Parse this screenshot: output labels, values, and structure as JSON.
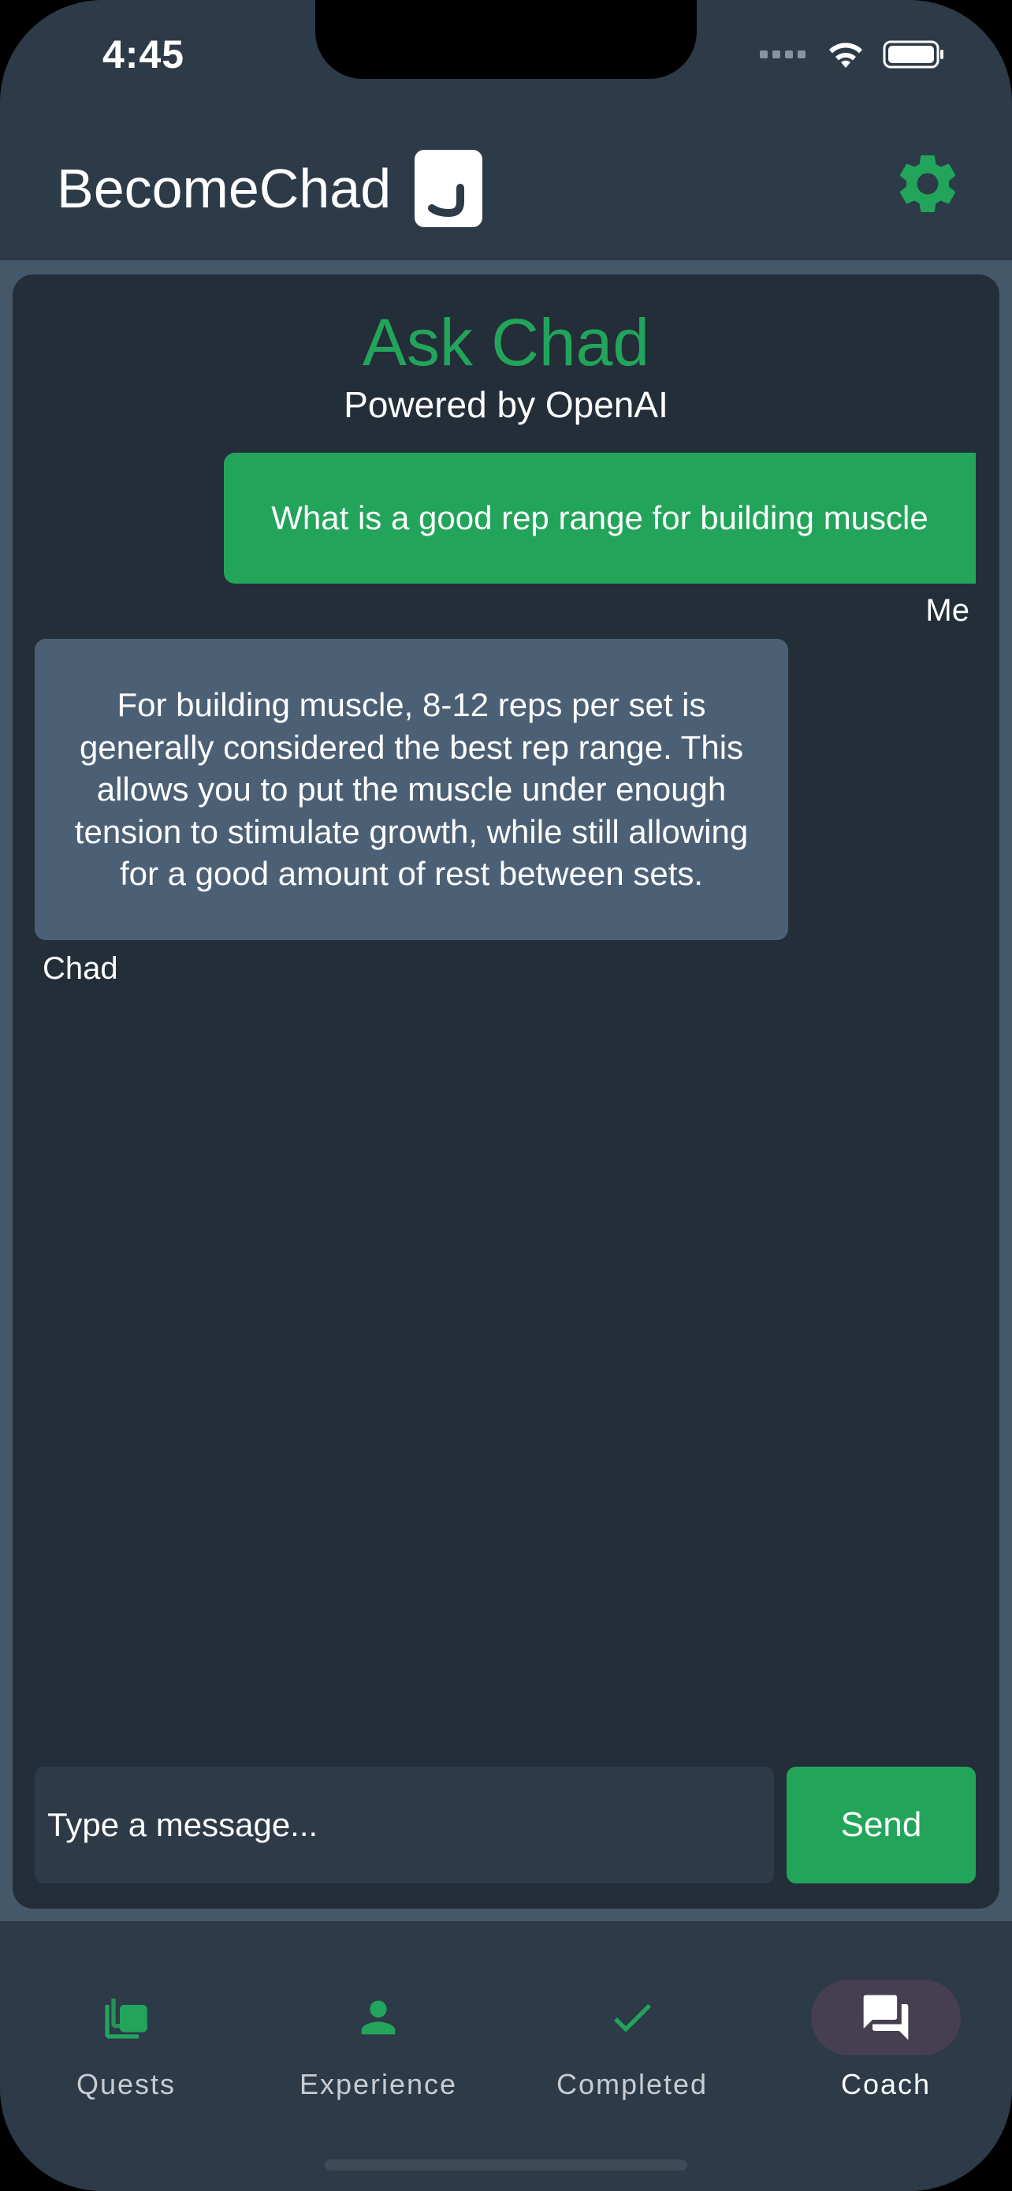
{
  "status_bar": {
    "time": "4:45"
  },
  "header": {
    "brand": "BecomeChad",
    "settings_icon": "gear-icon"
  },
  "chat": {
    "title": "Ask Chad",
    "subtitle": "Powered by OpenAI",
    "messages": [
      {
        "sender": "Me",
        "text": "What is a good rep range for building muscle"
      },
      {
        "sender": "Chad",
        "text": "For building muscle, 8-12 reps per set is generally considered the best rep range. This allows you to put the muscle under enough tension to stimulate growth, while still allowing for a good amount of rest between sets."
      }
    ],
    "input": {
      "value": "Type a message..."
    },
    "send_label": "Send"
  },
  "nav": {
    "items": [
      {
        "label": "Quests",
        "icon": "stacked-squares-icon"
      },
      {
        "label": "Experience",
        "icon": "person-icon"
      },
      {
        "label": "Completed",
        "icon": "checkmark-icon"
      },
      {
        "label": "Coach",
        "icon": "chat-bubbles-icon",
        "active": true
      }
    ]
  },
  "colors": {
    "accent": "#22a55a",
    "background": "#2d3a48",
    "card": "#232e39",
    "bot_bubble": "#4b6075"
  }
}
